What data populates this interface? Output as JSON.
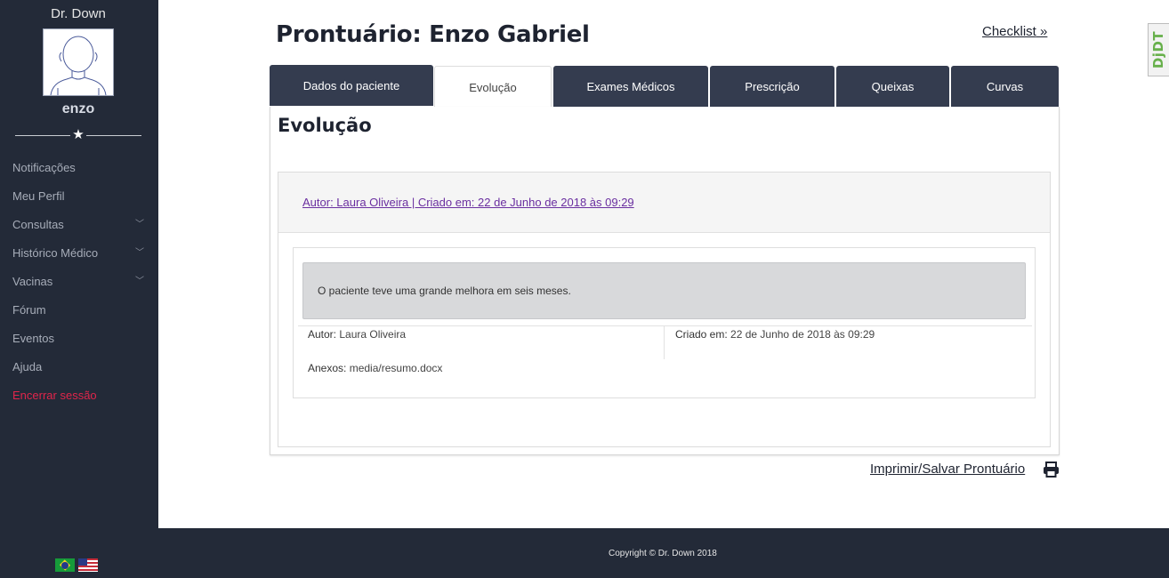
{
  "sidebar": {
    "brand": "Dr. Down",
    "username": "enzo",
    "menu": [
      {
        "label": "Notificações"
      },
      {
        "label": "Meu Perfil"
      },
      {
        "label": "Consultas"
      },
      {
        "label": "Histórico Médico"
      },
      {
        "label": "Vacinas"
      },
      {
        "label": "Fórum"
      },
      {
        "label": "Eventos"
      },
      {
        "label": "Ajuda"
      },
      {
        "label": "Encerrar sessão"
      }
    ]
  },
  "header": {
    "title": "Prontuário: Enzo Gabriel",
    "checklist": "Checklist",
    "badge": "DjDT"
  },
  "tabs": [
    {
      "label": "Dados do paciente"
    },
    {
      "label": "Evolução"
    },
    {
      "label": "Exames Médicos"
    },
    {
      "label": "Prescrição"
    },
    {
      "label": "Queixas"
    },
    {
      "label": "Curvas"
    }
  ],
  "evolution": {
    "title": "Evolução",
    "entry_link": "Autor: Laura Oliveira | Criado em: 22 de Junho de 2018 às 09:29",
    "note": "O paciente teve uma grande melhora em seis meses.",
    "author_label": "Autor:",
    "author": "Laura Oliveira",
    "created_label": "Criado em:",
    "created": "22 de Junho de 2018 às 09:29",
    "attachments_label": "Anexos:",
    "attachment": "media/resumo.docx"
  },
  "print_link": "Imprimir/Salvar Prontuário",
  "footer": {
    "copyright": "Copyright © Dr. Down 2018"
  },
  "colors": {
    "sidebar": "#232a38",
    "tab": "#343c4f",
    "logout": "#e0254b",
    "link": "#6a2fa0"
  }
}
